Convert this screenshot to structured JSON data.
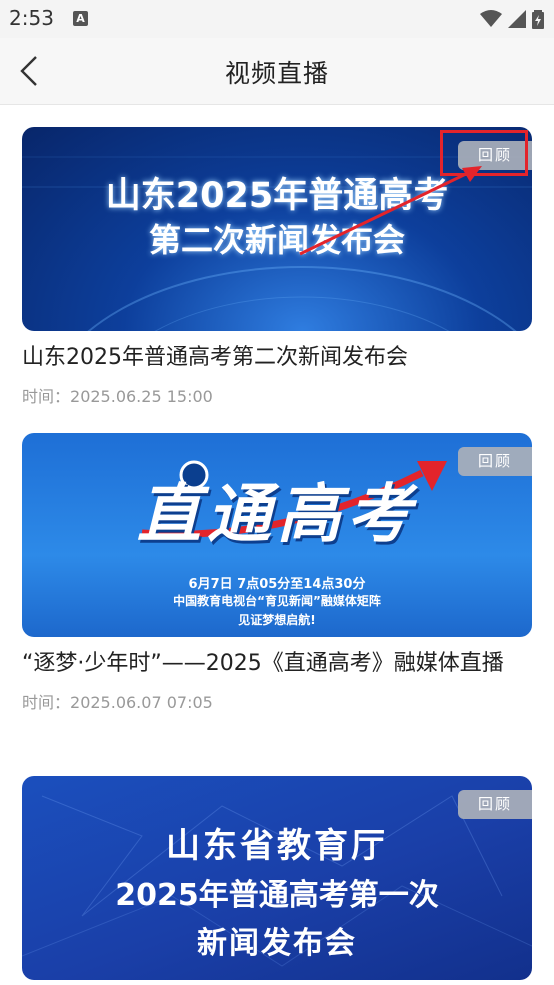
{
  "status_bar": {
    "time": "2:53",
    "notif_icon": "A"
  },
  "header": {
    "title": "视频直播"
  },
  "cards": [
    {
      "banner_lines": [
        "山东2025年普通高考",
        "第二次新闻发布会"
      ],
      "badge": "回顾",
      "title": "山东2025年普通高考第二次新闻发布会",
      "time_label": "时间：",
      "time": "2025.06.25 15:00"
    },
    {
      "banner_main": "直通高考",
      "banner_lines": [
        "6月7日 7点05分至14点30分",
        "中国教育电视台“育见新闻”融媒体矩阵",
        "见证梦想启航!"
      ],
      "badge": "回顾",
      "title": "“逐梦·少年时”——2025《直通高考》融媒体直播",
      "time_label": "时间：",
      "time": "2025.06.07 07:05"
    },
    {
      "banner_lines": [
        "山东省教育厅",
        "2025年普通高考第一次",
        "新闻发布会"
      ],
      "badge": "回顾"
    }
  ],
  "colors": {
    "accent_red": "#e3242b",
    "badge_bg": "#aab0ba"
  }
}
